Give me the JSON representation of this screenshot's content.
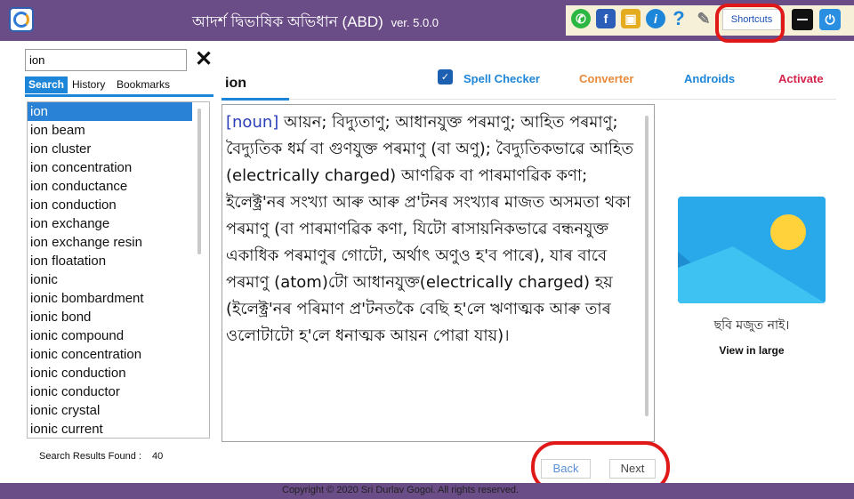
{
  "window": {
    "title": "আদৰ্শ দ্বিভাষিক অভিধান (ABD)",
    "version": "ver. 5.0.0",
    "toolbar_icons": [
      "whatsapp-icon",
      "facebook-icon",
      "lock-icon",
      "info-icon",
      "help-icon",
      "wrench-icon"
    ],
    "shortcuts_label": "Shortcuts"
  },
  "search": {
    "value": "ion",
    "tabs": [
      "Search",
      "History",
      "Bookmarks"
    ],
    "active_tab": "Search"
  },
  "word_list": [
    "ion",
    "ion beam",
    "ion cluster",
    "ion concentration",
    "ion conductance",
    "ion conduction",
    "ion exchange",
    "ion exchange resin",
    "ion floatation",
    "ionic",
    "ionic bombardment",
    "ionic bond",
    "ionic compound",
    "ionic concentration",
    "ionic conduction",
    "ionic conductor",
    "ionic crystal",
    "ionic current"
  ],
  "selected_word_index": 0,
  "results": {
    "label": "Search Results Found :",
    "count": "40"
  },
  "nav": {
    "spell_checker": "Spell Checker",
    "converter": "Converter",
    "androids": "Androids",
    "activate": "Activate"
  },
  "entry": {
    "word": "ion",
    "part_of_speech": "[noun]",
    "definition": " আয়ন; বিদ্যুতাণু; আধানযুক্ত পৰমাণু; আহিত পৰমাণু; বৈদ্যুতিক ধৰ্ম বা গুণযুক্ত পৰমাণু (বা অণু); বৈদ্যুতিকভাৱে আহিত (electrically charged) আণৱিক বা পাৰমাণৱিক কণা; ইলেক্ট্ৰ'নৰ সংখ্যা আৰু আৰু প্ৰ'টনৰ সংখ্যাৰ মাজত অসমতা থকা পৰমাণু (বা পাৰমাণৱিক কণা, যিটো ৰাসায়নিকভাৱে বন্ধনযুক্ত একাধিক পৰমাণুৰ গোটো, অৰ্থাৎ অণুও হ'ব পাৰে), যাৰ বাবে পৰমাণু (atom)টো আধানযুক্ত(electrically charged) হয় (ইলেক্ট্ৰ'নৰ পৰিমাণ প্ৰ'টনতকৈ বেছি হ'লে ঋণাত্মক আৰু তাৰ ওলোটাটো হ'লে ধনাত্মক আয়ন পোৱা যায়)।"
  },
  "image": {
    "caption": "ছবি মজুত নাই।",
    "view_large": "View in large",
    "colors": {
      "sky": "#29a9e9",
      "sun": "#ffd23c",
      "hill_back": "#1f8ed0",
      "hill_front": "#3dc2f2"
    }
  },
  "pager": {
    "back": "Back",
    "next": "Next"
  },
  "footer": {
    "copyright": "Copyright ©  2020 Sri Durlav Gogoi. All rights reserved."
  },
  "colors": {
    "titlebar": "#6a4c86",
    "accent": "#1e86d8",
    "annotation_red": "#e01818"
  }
}
